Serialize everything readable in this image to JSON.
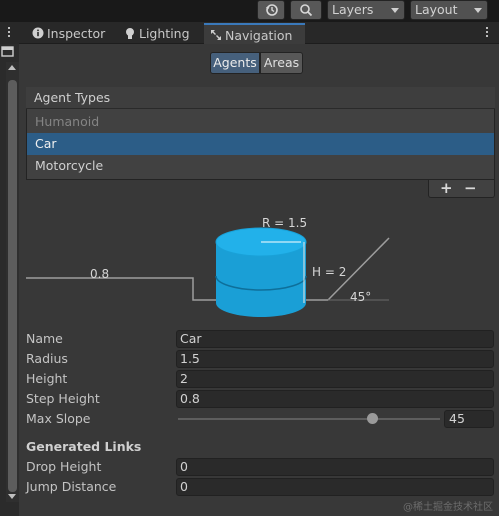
{
  "toolbar": {
    "history_icon": "history-icon",
    "search_icon": "search-icon",
    "layers_label": "Layers",
    "layout_label": "Layout"
  },
  "tabs": [
    {
      "label": "Inspector",
      "icon": "info-icon",
      "active": false
    },
    {
      "label": "Lighting",
      "icon": "lightbulb-icon",
      "active": false
    },
    {
      "label": "Navigation",
      "icon": "navigation-icon",
      "active": true
    }
  ],
  "segmented": {
    "agents": "Agents",
    "areas": "Areas",
    "selected": "Agents"
  },
  "agent_list": {
    "header": "Agent Types",
    "items": [
      "Humanoid",
      "Car",
      "Motorcycle"
    ],
    "selected_index": 1,
    "add_label": "+",
    "remove_label": "−"
  },
  "diagram": {
    "radius_label": "R = 1.5",
    "height_label": "H = 2",
    "step_label": "0.8",
    "slope_label": "45°"
  },
  "properties": {
    "name": {
      "label": "Name",
      "value": "Car"
    },
    "radius": {
      "label": "Radius",
      "value": "1.5"
    },
    "height": {
      "label": "Height",
      "value": "2"
    },
    "step_height": {
      "label": "Step Height",
      "value": "0.8"
    },
    "max_slope": {
      "label": "Max Slope",
      "value": "45",
      "fraction": 0.74
    }
  },
  "generated_links": {
    "title": "Generated Links",
    "drop_height": {
      "label": "Drop Height",
      "value": "0"
    },
    "jump_distance": {
      "label": "Jump Distance",
      "value": "0"
    }
  },
  "watermark": "@稀土掘金技术社区",
  "colors": {
    "accent": "#3a79bb",
    "selected_row": "#2c5d87",
    "cylinder": "#1ea6de"
  }
}
